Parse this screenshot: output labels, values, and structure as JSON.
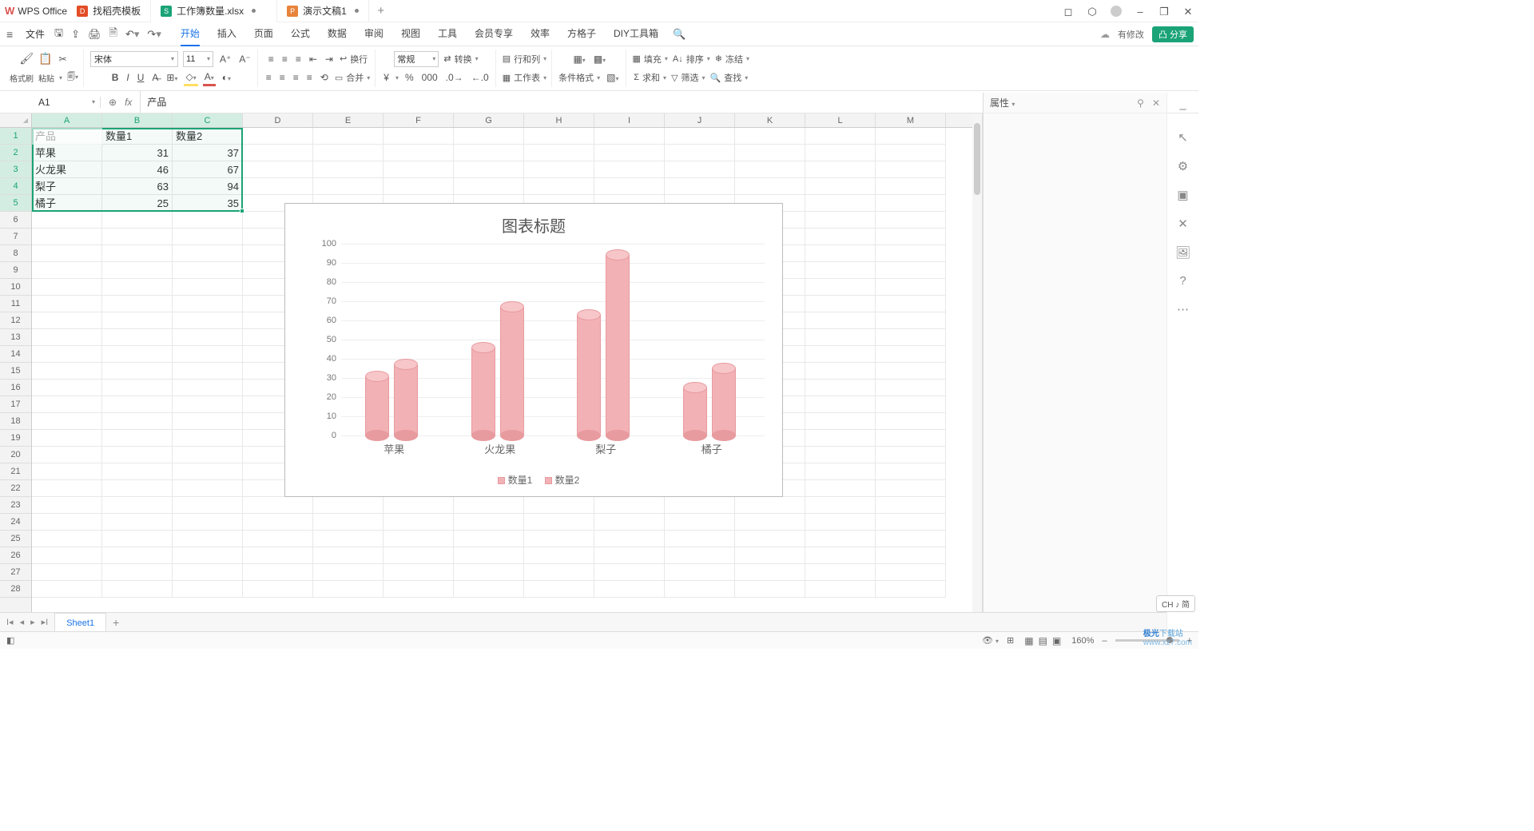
{
  "app": {
    "name": "WPS Office"
  },
  "tabs": [
    {
      "icon": "red",
      "label": "找稻壳模板"
    },
    {
      "icon": "green",
      "label": "工作簿数量.xlsx",
      "dirty": true,
      "active": true
    },
    {
      "icon": "orange",
      "label": "演示文稿1",
      "dirty": true
    }
  ],
  "window": {
    "min": "–",
    "restore": "❐",
    "close": "✕",
    "cube": "⬡",
    "sq": "◻"
  },
  "menu": {
    "file": "文件",
    "items": [
      "开始",
      "插入",
      "页面",
      "公式",
      "数据",
      "审阅",
      "视图",
      "工具",
      "会员专享",
      "效率",
      "方格子",
      "DIY工具箱"
    ],
    "active": "开始",
    "cloud": "有修改",
    "share": "分享"
  },
  "ribbon": {
    "format_brush": "格式刷",
    "paste": "粘贴",
    "font_name": "宋体",
    "font_size": "11",
    "wrap": "换行",
    "general": "常规",
    "convert": "转换",
    "rowscols": "行和列",
    "worksheet": "工作表",
    "cond_fmt": "条件格式",
    "fill": "填充",
    "sort": "排序",
    "freeze": "冻结",
    "sum": "求和",
    "filter": "筛选",
    "find": "查找",
    "merge": "合并",
    "currency": "¥",
    "percent": "%"
  },
  "name_box": "A1",
  "formula_value": "产品",
  "columns": [
    "A",
    "B",
    "C",
    "D",
    "E",
    "F",
    "G",
    "H",
    "I",
    "J",
    "K",
    "L",
    "M"
  ],
  "table": {
    "headers": [
      "产品",
      "数量1",
      "数量2"
    ],
    "rows": [
      [
        "苹果",
        "31",
        "37"
      ],
      [
        "火龙果",
        "46",
        "67"
      ],
      [
        "梨子",
        "63",
        "94"
      ],
      [
        "橘子",
        "25",
        "35"
      ]
    ]
  },
  "chart_data": {
    "type": "bar",
    "title": "图表标题",
    "categories": [
      "苹果",
      "火龙果",
      "梨子",
      "橘子"
    ],
    "series": [
      {
        "name": "数量1",
        "values": [
          31,
          46,
          63,
          25
        ]
      },
      {
        "name": "数量2",
        "values": [
          37,
          67,
          94,
          35
        ]
      }
    ],
    "ylim": [
      0,
      100
    ],
    "yticks": [
      0,
      10,
      20,
      30,
      40,
      50,
      60,
      70,
      80,
      90,
      100
    ],
    "legend": [
      "数量1",
      "数量2"
    ]
  },
  "right_panel": {
    "title": "属性",
    "pin": "⚲",
    "close": "✕",
    "collapse": "–"
  },
  "sheet_tabs": {
    "active": "Sheet1"
  },
  "status": {
    "zoom": "160%",
    "ime": "CH ♪ 简",
    "ready": "◧"
  },
  "watermark": {
    "brand": "极光",
    "text": "下载站",
    "url": "www.xz7.com"
  }
}
